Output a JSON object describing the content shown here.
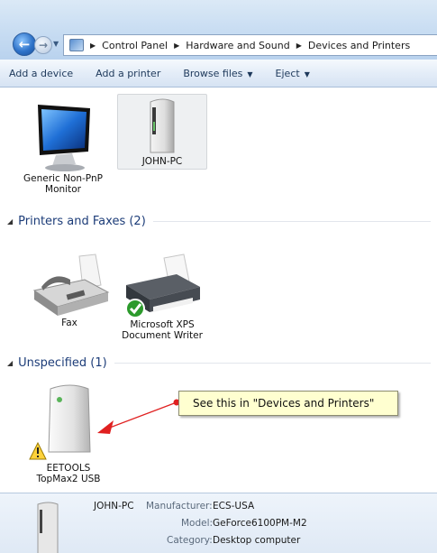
{
  "address": {
    "crumbs": [
      "Control Panel",
      "Hardware and Sound",
      "Devices and Printers"
    ]
  },
  "toolbar": {
    "add_device": "Add a device",
    "add_printer": "Add a printer",
    "browse_files": "Browse files",
    "eject": "Eject"
  },
  "devices": {
    "monitor": {
      "line1": "Generic Non-PnP",
      "line2": "Monitor"
    },
    "computer": {
      "line1": "JOHN-PC"
    }
  },
  "groups": {
    "printers": "Printers and Faxes (2)",
    "unspecified": "Unspecified (1)"
  },
  "printers": {
    "fax": {
      "line1": "Fax"
    },
    "xps": {
      "line1": "Microsoft XPS",
      "line2": "Document Writer"
    }
  },
  "unspecified": {
    "eetools": {
      "line1": "EETOOLS",
      "line2": "TopMax2 USB"
    }
  },
  "callout": {
    "text": "See this in \"Devices and Printers\""
  },
  "details": {
    "name": "JOHN-PC",
    "manufacturer_label": "Manufacturer:",
    "manufacturer": "ECS-USA",
    "model_label": "Model:",
    "model": "GeForce6100PM-M2",
    "category_label": "Category:",
    "category": "Desktop computer"
  },
  "colors": {
    "accent": "#1c3c78",
    "callout_bg": "#ffffd0",
    "arrow": "#e02020"
  }
}
